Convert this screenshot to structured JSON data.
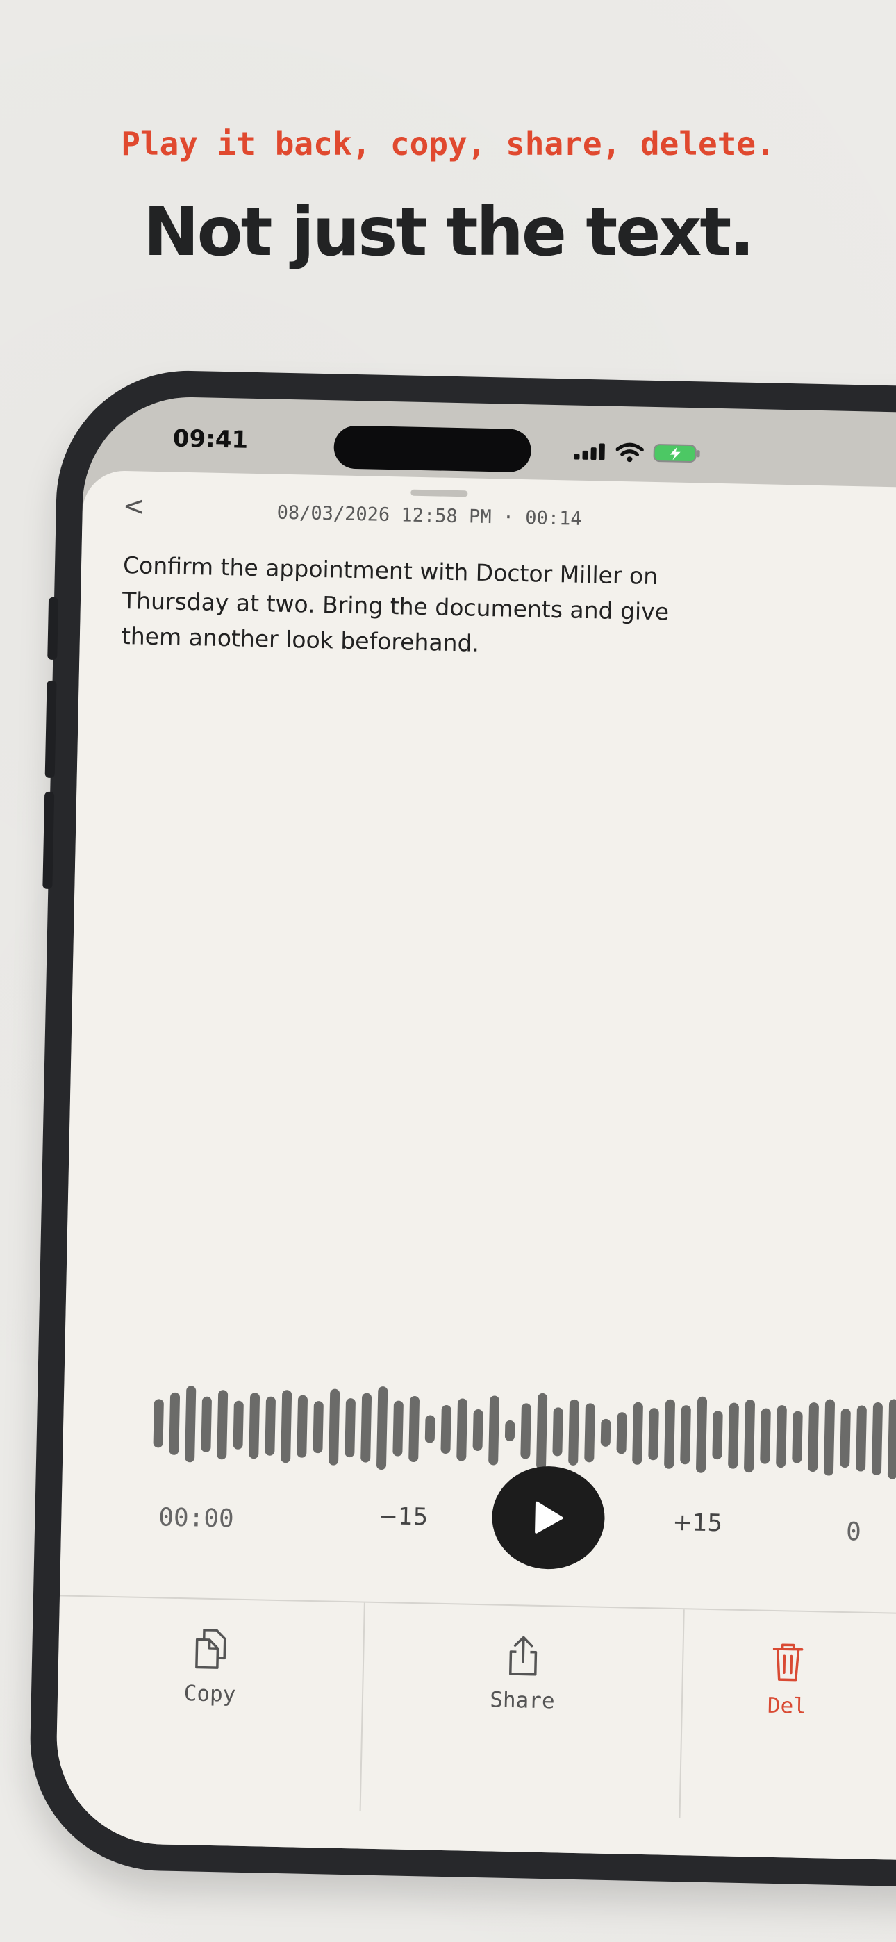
{
  "marketing": {
    "tagline": "Play it back, copy, share, delete.",
    "headline": "Not just the text."
  },
  "status_bar": {
    "time": "09:41",
    "icons": [
      "signal-icon",
      "wifi-icon",
      "battery-charging-icon"
    ]
  },
  "note": {
    "back_icon": "<",
    "meta": "08/03/2026 12:58 PM · 00:14",
    "transcript": "Confirm the appointment with Doctor Miller on Thursday at two. Bring the documents and give them another look beforehand."
  },
  "player": {
    "time_start": "00:00",
    "skip_back": "−15",
    "skip_forward": "+15",
    "time_end": "0"
  },
  "actions": {
    "copy": "Copy",
    "share": "Share",
    "delete": "Del"
  },
  "colors": {
    "accent": "#e0492f",
    "headline": "#222324",
    "sheet": "#f3f1ec",
    "waveform": "#6b6b69",
    "delete": "#d94a33"
  }
}
